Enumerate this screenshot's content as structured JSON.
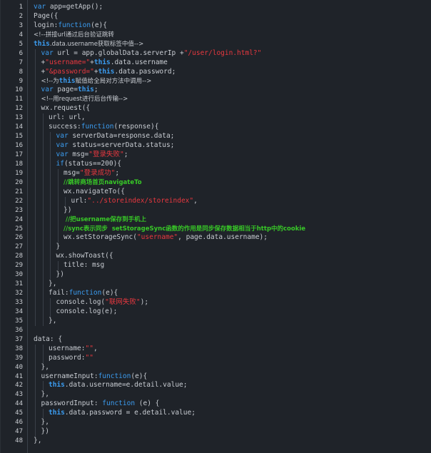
{
  "editor": {
    "lines": [
      {
        "n": "1",
        "indent": 0,
        "parts": [
          {
            "t": "var",
            "c": "kw"
          },
          {
            "t": " app=getApp();",
            "c": "txt"
          }
        ]
      },
      {
        "n": "2",
        "indent": 0,
        "parts": [
          {
            "t": "Page({",
            "c": "txt"
          }
        ]
      },
      {
        "n": "3",
        "indent": 0,
        "parts": [
          {
            "t": "login:",
            "c": "txt"
          },
          {
            "t": "function",
            "c": "kw"
          },
          {
            "t": "(e){",
            "c": "txt"
          }
        ]
      },
      {
        "n": "4",
        "indent": 0,
        "parts": [
          {
            "t": "<!--拼接url通过后台验证跳转",
            "c": "html"
          }
        ]
      },
      {
        "n": "5",
        "indent": 0,
        "parts": [
          {
            "t": "this",
            "c": "this"
          },
          {
            "t": ".data.username获取标签中值-->",
            "c": "html"
          }
        ]
      },
      {
        "n": "6",
        "indent": 1,
        "parts": [
          {
            "t": "var",
            "c": "kw"
          },
          {
            "t": " url = app.globalData.serverIp +",
            "c": "txt"
          },
          {
            "t": "\"/user/login.html?\"",
            "c": "str"
          }
        ]
      },
      {
        "n": "7",
        "indent": 1,
        "parts": [
          {
            "t": "+",
            "c": "txt"
          },
          {
            "t": "\"username=\"",
            "c": "str"
          },
          {
            "t": "+",
            "c": "txt"
          },
          {
            "t": "this",
            "c": "this"
          },
          {
            "t": ".data.username",
            "c": "txt"
          }
        ]
      },
      {
        "n": "8",
        "indent": 1,
        "parts": [
          {
            "t": "+",
            "c": "txt"
          },
          {
            "t": "\"&password=\"",
            "c": "str"
          },
          {
            "t": "+",
            "c": "txt"
          },
          {
            "t": "this",
            "c": "this"
          },
          {
            "t": ".data.password;",
            "c": "txt"
          }
        ]
      },
      {
        "n": "9",
        "indent": 1,
        "parts": [
          {
            "t": "<!--为",
            "c": "html"
          },
          {
            "t": "this",
            "c": "this"
          },
          {
            "t": "赋值给全局对方法中调用-->",
            "c": "html"
          }
        ]
      },
      {
        "n": "10",
        "indent": 1,
        "parts": [
          {
            "t": "var",
            "c": "kw"
          },
          {
            "t": " page=",
            "c": "txt"
          },
          {
            "t": "this",
            "c": "this"
          },
          {
            "t": ";",
            "c": "txt"
          }
        ]
      },
      {
        "n": "11",
        "indent": 1,
        "parts": [
          {
            "t": "<!--用request进行后台传输-->",
            "c": "html"
          }
        ]
      },
      {
        "n": "12",
        "indent": 1,
        "parts": [
          {
            "t": "wx.request({",
            "c": "txt"
          }
        ]
      },
      {
        "n": "13",
        "indent": 2,
        "parts": [
          {
            "t": "url: url,",
            "c": "txt"
          }
        ]
      },
      {
        "n": "14",
        "indent": 2,
        "parts": [
          {
            "t": "success:",
            "c": "txt"
          },
          {
            "t": "function",
            "c": "kw"
          },
          {
            "t": "(response){",
            "c": "txt"
          }
        ]
      },
      {
        "n": "15",
        "indent": 3,
        "parts": [
          {
            "t": "var",
            "c": "kw"
          },
          {
            "t": " serverData=response.data;",
            "c": "txt"
          }
        ]
      },
      {
        "n": "16",
        "indent": 3,
        "parts": [
          {
            "t": "var",
            "c": "kw"
          },
          {
            "t": " status=serverData.status;",
            "c": "txt"
          }
        ]
      },
      {
        "n": "17",
        "indent": 3,
        "parts": [
          {
            "t": "var",
            "c": "kw"
          },
          {
            "t": " msg=",
            "c": "txt"
          },
          {
            "t": "\"登录失败\"",
            "c": "str"
          },
          {
            "t": ";",
            "c": "txt"
          }
        ]
      },
      {
        "n": "18",
        "indent": 3,
        "parts": [
          {
            "t": "if",
            "c": "kw"
          },
          {
            "t": "(status==200){",
            "c": "txt"
          }
        ]
      },
      {
        "n": "19",
        "indent": 4,
        "parts": [
          {
            "t": "msg=",
            "c": "txt"
          },
          {
            "t": "\"登录成功\"",
            "c": "str"
          },
          {
            "t": ";",
            "c": "txt"
          }
        ]
      },
      {
        "n": "20",
        "indent": 4,
        "parts": [
          {
            "t": "//跳转商场首页navigateTo",
            "c": "cm"
          }
        ]
      },
      {
        "n": "21",
        "indent": 4,
        "parts": [
          {
            "t": "wx.navigateTo({",
            "c": "txt"
          }
        ]
      },
      {
        "n": "22",
        "indent": 5,
        "parts": [
          {
            "t": "url:",
            "c": "txt"
          },
          {
            "t": "\"../storeindex/storeindex\"",
            "c": "str"
          },
          {
            "t": ",",
            "c": "txt"
          }
        ]
      },
      {
        "n": "23",
        "indent": 4,
        "parts": [
          {
            "t": "})",
            "c": "txt"
          }
        ]
      },
      {
        "n": "24",
        "indent": 4,
        "parts": [
          {
            "t": " //把username保存到手机上",
            "c": "cm"
          }
        ]
      },
      {
        "n": "25",
        "indent": 4,
        "parts": [
          {
            "t": "//sync表示同步  setStorageSync函数的作用是同步保存数据相当于http中的cookie",
            "c": "cm"
          }
        ]
      },
      {
        "n": "26",
        "indent": 4,
        "parts": [
          {
            "t": "wx.setStorageSync(",
            "c": "txt"
          },
          {
            "t": "\"username\"",
            "c": "str"
          },
          {
            "t": ", page.data.username);",
            "c": "txt"
          }
        ]
      },
      {
        "n": "27",
        "indent": 3,
        "parts": [
          {
            "t": "}",
            "c": "txt"
          }
        ]
      },
      {
        "n": "28",
        "indent": 3,
        "parts": [
          {
            "t": "wx.showToast({",
            "c": "txt"
          }
        ]
      },
      {
        "n": "29",
        "indent": 4,
        "parts": [
          {
            "t": "title: msg",
            "c": "txt"
          }
        ]
      },
      {
        "n": "30",
        "indent": 3,
        "parts": [
          {
            "t": "})",
            "c": "txt"
          }
        ]
      },
      {
        "n": "31",
        "indent": 2,
        "parts": [
          {
            "t": "},",
            "c": "txt"
          }
        ]
      },
      {
        "n": "32",
        "indent": 2,
        "parts": [
          {
            "t": "fail:",
            "c": "txt"
          },
          {
            "t": "function",
            "c": "kw"
          },
          {
            "t": "(e){",
            "c": "txt"
          }
        ]
      },
      {
        "n": "33",
        "indent": 3,
        "parts": [
          {
            "t": "console.log(",
            "c": "txt"
          },
          {
            "t": "\"联网失败\"",
            "c": "str"
          },
          {
            "t": ");",
            "c": "txt"
          }
        ]
      },
      {
        "n": "34",
        "indent": 3,
        "parts": [
          {
            "t": "console.log(e);",
            "c": "txt"
          }
        ]
      },
      {
        "n": "35",
        "indent": 2,
        "parts": [
          {
            "t": "},",
            "c": "txt"
          }
        ]
      },
      {
        "n": "36",
        "indent": 0,
        "parts": []
      },
      {
        "n": "37",
        "indent": 0,
        "parts": [
          {
            "t": "data: {",
            "c": "txt"
          }
        ]
      },
      {
        "n": "38",
        "indent": 2,
        "parts": [
          {
            "t": "username:",
            "c": "txt"
          },
          {
            "t": "\"\"",
            "c": "str"
          },
          {
            "t": ",",
            "c": "txt"
          }
        ]
      },
      {
        "n": "39",
        "indent": 2,
        "parts": [
          {
            "t": "password:",
            "c": "txt"
          },
          {
            "t": "\"\"",
            "c": "str"
          }
        ]
      },
      {
        "n": "40",
        "indent": 1,
        "parts": [
          {
            "t": "},",
            "c": "txt"
          }
        ]
      },
      {
        "n": "41",
        "indent": 1,
        "parts": [
          {
            "t": "usernameInput:",
            "c": "txt"
          },
          {
            "t": "function",
            "c": "kw"
          },
          {
            "t": "(e){",
            "c": "txt"
          }
        ]
      },
      {
        "n": "42",
        "indent": 2,
        "parts": [
          {
            "t": "this",
            "c": "this"
          },
          {
            "t": ".data.username=e.detail.value;",
            "c": "txt"
          }
        ]
      },
      {
        "n": "43",
        "indent": 1,
        "parts": [
          {
            "t": "},",
            "c": "txt"
          }
        ]
      },
      {
        "n": "44",
        "indent": 1,
        "parts": [
          {
            "t": "passwordInput: ",
            "c": "txt"
          },
          {
            "t": "function",
            "c": "kw"
          },
          {
            "t": " (e) {",
            "c": "txt"
          }
        ]
      },
      {
        "n": "45",
        "indent": 2,
        "parts": [
          {
            "t": "this",
            "c": "this"
          },
          {
            "t": ".data.password = e.detail.value;",
            "c": "txt"
          }
        ]
      },
      {
        "n": "46",
        "indent": 1,
        "parts": [
          {
            "t": "},",
            "c": "txt"
          }
        ]
      },
      {
        "n": "47",
        "indent": 1,
        "parts": [
          {
            "t": "})",
            "c": "txt"
          }
        ]
      },
      {
        "n": "48",
        "indent": 0,
        "parts": [
          {
            "t": "},",
            "c": "txt"
          }
        ]
      }
    ]
  }
}
